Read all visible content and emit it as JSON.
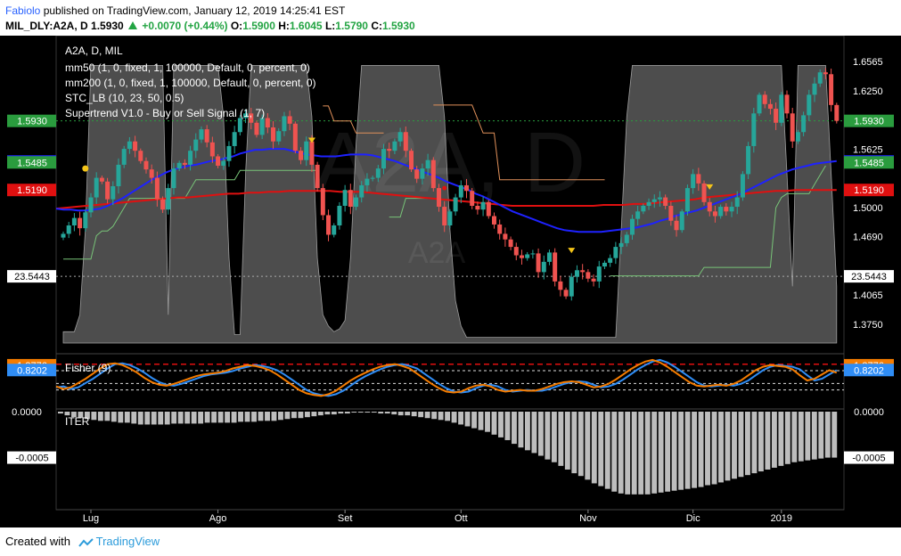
{
  "header": {
    "author": "Fabiolo",
    "published_text": "published on TradingView.com, January 12, 2019 14:25:41 EST",
    "symbol": "MIL_DLY:A2A, D",
    "price": "1.5930",
    "change": "+0.0070 (+0.44%)",
    "o_label": "O:",
    "o_value": "1.5900",
    "h_label": "H:",
    "h_value": "1.6045",
    "l_label": "L:",
    "l_value": "1.5790",
    "c_label": "C:",
    "c_value": "1.5930"
  },
  "footer": {
    "created_with": "Created with",
    "brand": "TradingView"
  },
  "colors": {
    "background": "#000000",
    "up_candle": "#26a69a",
    "down_candle": "#ef5350",
    "mm50": "#1e22ff",
    "mm200": "#e01010",
    "stc": "#8c8c8c",
    "supertrend_long": "#78c478",
    "supertrend_short": "#e0905a",
    "fisher": "#f57c00",
    "fisher_trigger": "#2f8df5",
    "iter_bars": "#bdbdbd",
    "last_price_label": "#2a9c3e"
  },
  "chart_data": {
    "type": "candlestick",
    "main_pane": {
      "symbol_title": "A2A, D, MIL",
      "watermark": "A2A, D",
      "watermark_sub": "A2A",
      "legend": [
        "mm50 (1, 0, fixed, 1, 100000, Default, 0, percent, 0)",
        "mm200 (1, 0, fixed, 1, 100000, Default, 0, percent, 0)",
        "STC_LB (10, 23, 50, 0.5)",
        "Supertrend V1.0 - Buy or Sell Signal (1, 7)"
      ],
      "ylim": [
        1.355,
        1.67
      ],
      "y_ticks": [
        "1.6565",
        "1.6250",
        "1.5625",
        "1.5000",
        "1.4690",
        "1.4065",
        "1.3750"
      ],
      "x_ticks": [
        {
          "label": "Lug",
          "bar": 5
        },
        {
          "label": "Ago",
          "bar": 28
        },
        {
          "label": "Set",
          "bar": 51
        },
        {
          "label": "Ott",
          "bar": 72
        },
        {
          "label": "Nov",
          "bar": 95
        },
        {
          "label": "Dic",
          "bar": 114
        },
        {
          "label": "2019",
          "bar": 130
        }
      ],
      "price_labels": [
        {
          "text": "1.5930",
          "value": 1.593,
          "color": "#2a9c3e"
        },
        {
          "text": "1.5495",
          "value": 1.5495,
          "color": "#1e22ff"
        },
        {
          "text": "1.5485",
          "value": 1.5485,
          "color": "#2a9c3e"
        },
        {
          "text": "1.5190",
          "value": 1.519,
          "color": "#e01010"
        }
      ],
      "stc_label": {
        "text": "23.5443",
        "value": 23.5443
      },
      "closes": [
        1.472,
        1.481,
        1.489,
        1.478,
        1.495,
        1.511,
        1.532,
        1.528,
        1.509,
        1.523,
        1.546,
        1.563,
        1.571,
        1.561,
        1.55,
        1.541,
        1.532,
        1.509,
        1.498,
        1.521,
        1.542,
        1.548,
        1.546,
        1.561,
        1.573,
        1.584,
        1.57,
        1.555,
        1.545,
        1.55,
        1.566,
        1.581,
        1.596,
        1.601,
        1.591,
        1.578,
        1.596,
        1.586,
        1.571,
        1.582,
        1.598,
        1.59,
        1.561,
        1.551,
        1.571,
        1.546,
        1.521,
        1.492,
        1.471,
        1.481,
        1.502,
        1.519,
        1.501,
        1.511,
        1.524,
        1.531,
        1.532,
        1.542,
        1.563,
        1.561,
        1.571,
        1.581,
        1.561,
        1.541,
        1.531,
        1.542,
        1.551,
        1.521,
        1.501,
        1.481,
        1.496,
        1.511,
        1.524,
        1.518,
        1.502,
        1.498,
        1.506,
        1.491,
        1.482,
        1.472,
        1.466,
        1.458,
        1.449,
        1.446,
        1.45,
        1.451,
        1.431,
        1.442,
        1.452,
        1.421,
        1.412,
        1.405,
        1.426,
        1.433,
        1.431,
        1.424,
        1.421,
        1.437,
        1.441,
        1.446,
        1.458,
        1.462,
        1.471,
        1.488,
        1.496,
        1.502,
        1.506,
        1.509,
        1.511,
        1.502,
        1.486,
        1.476,
        1.496,
        1.521,
        1.536,
        1.526,
        1.506,
        1.496,
        1.491,
        1.501,
        1.496,
        1.501,
        1.511,
        1.536,
        1.566,
        1.601,
        1.621,
        1.611,
        1.606,
        1.591,
        1.621,
        1.601,
        1.571,
        1.581,
        1.599,
        1.621,
        1.633,
        1.645,
        1.643,
        1.61,
        1.593
      ],
      "mm50": [
        1.499,
        1.498,
        1.498,
        1.497,
        1.497,
        1.498,
        1.499,
        1.502,
        1.506,
        1.51,
        1.515,
        1.52,
        1.525,
        1.53,
        1.534,
        1.538,
        1.541,
        1.543,
        1.545,
        1.546,
        1.548,
        1.55,
        1.551,
        1.553,
        1.555,
        1.558,
        1.56,
        1.562,
        1.562,
        1.563,
        1.563,
        1.563,
        1.561,
        1.559,
        1.557,
        1.556,
        1.555,
        1.555,
        1.555,
        1.556,
        1.557,
        1.557,
        1.557,
        1.556,
        1.554,
        1.552,
        1.55,
        1.547,
        1.544,
        1.541,
        1.538,
        1.535,
        1.532,
        1.528,
        1.525,
        1.522,
        1.519,
        1.515,
        1.512,
        1.508,
        1.504,
        1.5,
        1.496,
        1.493,
        1.49,
        1.487,
        1.484,
        1.481,
        1.478,
        1.476,
        1.475,
        1.474,
        1.474,
        1.474,
        1.474,
        1.475,
        1.476,
        1.477,
        1.478,
        1.479,
        1.481,
        1.483,
        1.486,
        1.488,
        1.491,
        1.493,
        1.495,
        1.497,
        1.5,
        1.503,
        1.506,
        1.509,
        1.512,
        1.515,
        1.519,
        1.523,
        1.527,
        1.531,
        1.535,
        1.538,
        1.541,
        1.543,
        1.545,
        1.547,
        1.548,
        1.549,
        1.55
      ],
      "mm200": [
        1.499,
        1.5,
        1.501,
        1.502,
        1.503,
        1.504,
        1.505,
        1.506,
        1.507,
        1.508,
        1.509,
        1.51,
        1.511,
        1.511,
        1.512,
        1.513,
        1.514,
        1.515,
        1.515,
        1.516,
        1.516,
        1.517,
        1.517,
        1.518,
        1.518,
        1.518,
        1.518,
        1.518,
        1.517,
        1.517,
        1.517,
        1.516,
        1.515,
        1.514,
        1.513,
        1.512,
        1.511,
        1.51,
        1.509,
        1.508,
        1.507,
        1.506,
        1.505,
        1.504,
        1.503,
        1.502,
        1.502,
        1.502,
        1.502,
        1.502,
        1.502,
        1.502,
        1.502,
        1.502,
        1.503,
        1.503,
        1.503,
        1.504,
        1.504,
        1.505,
        1.506,
        1.507,
        1.508,
        1.509,
        1.511,
        1.512,
        1.513,
        1.514,
        1.515,
        1.516,
        1.517,
        1.518,
        1.518,
        1.519,
        1.519,
        1.519,
        1.519,
        1.519
      ],
      "stc_percent": [
        4,
        4,
        4,
        10,
        40,
        98,
        98,
        98,
        98,
        98,
        98,
        98,
        98,
        98,
        98,
        98,
        98,
        98,
        98,
        10,
        98,
        98,
        98,
        98,
        98,
        98,
        98,
        98,
        98,
        80,
        30,
        3,
        3,
        60,
        98,
        98,
        98,
        98,
        98,
        98,
        98,
        98,
        98,
        98,
        98,
        80,
        30,
        10,
        6,
        4,
        5,
        8,
        30,
        70,
        98,
        98,
        98,
        98,
        98,
        98,
        98,
        98,
        98,
        98,
        98,
        98,
        98,
        98,
        98,
        80,
        40,
        15,
        6,
        2,
        2,
        2,
        2,
        2,
        2,
        2,
        2,
        2,
        2,
        2,
        2,
        2,
        2,
        2,
        2,
        2,
        2,
        2,
        2,
        2,
        2,
        2,
        2,
        2,
        2,
        2,
        2,
        40,
        80,
        98,
        98,
        98,
        98,
        98,
        98,
        98,
        98,
        98,
        98,
        98,
        98,
        98,
        98,
        98,
        98,
        98,
        98,
        98,
        98,
        98,
        98,
        98,
        98,
        98,
        98,
        98,
        98,
        60,
        20,
        98,
        98,
        98,
        98,
        98,
        98,
        60,
        20
      ],
      "supertrend_long": [
        1.445,
        1.445,
        1.445,
        1.445,
        1.445,
        1.445,
        1.47,
        1.475,
        1.475,
        1.48,
        1.49,
        1.5,
        1.51,
        1.51,
        1.51,
        1.51,
        1.51,
        1.51,
        1.51,
        1.51,
        1.51,
        1.51,
        1.51,
        1.52,
        1.53,
        1.53,
        1.53,
        1.53,
        1.53,
        1.53,
        1.53,
        1.53,
        1.54,
        1.54,
        1.54,
        1.54,
        1.54,
        1.54,
        1.54,
        1.54,
        1.54,
        1.54,
        1.54,
        1.54,
        1.54,
        1.54,
        1.54,
        null,
        null,
        null,
        null,
        null,
        null,
        null,
        null,
        null,
        null,
        null,
        null,
        1.49,
        1.49,
        1.49,
        1.51,
        1.51,
        1.51,
        1.51,
        1.51,
        null,
        null,
        null,
        null,
        null,
        null,
        null,
        null,
        null,
        null,
        null,
        null,
        null,
        null,
        null,
        null,
        null,
        null,
        null,
        null,
        null,
        null,
        null,
        null,
        null,
        null,
        null,
        null,
        null,
        null,
        null,
        null,
        1.427,
        1.427,
        1.427,
        1.427,
        1.427,
        1.427,
        1.427,
        1.427,
        1.427,
        1.427,
        1.427,
        1.427,
        1.427,
        1.427,
        1.427,
        1.427,
        1.427,
        1.436,
        1.436,
        1.436,
        1.436,
        1.436,
        1.436,
        1.436,
        1.436,
        1.436,
        1.436,
        1.436,
        1.436,
        1.436,
        1.5,
        1.511,
        1.515,
        1.515,
        1.515,
        1.515,
        1.515,
        1.525,
        1.535,
        1.545
      ],
      "supertrend_short": [
        null,
        null,
        null,
        null,
        null,
        null,
        null,
        null,
        null,
        null,
        null,
        null,
        null,
        null,
        null,
        null,
        null,
        null,
        null,
        null,
        null,
        null,
        null,
        null,
        null,
        null,
        null,
        null,
        null,
        null,
        null,
        null,
        null,
        null,
        null,
        null,
        null,
        null,
        null,
        null,
        null,
        null,
        null,
        null,
        null,
        null,
        null,
        1.609,
        1.609,
        1.593,
        1.593,
        1.593,
        1.593,
        1.58,
        1.58,
        1.58,
        1.58,
        1.58,
        1.58,
        null,
        null,
        null,
        null,
        null,
        null,
        null,
        null,
        1.61,
        1.61,
        1.61,
        1.61,
        1.61,
        1.61,
        1.61,
        1.61,
        1.595,
        1.58,
        1.58,
        1.58,
        1.53,
        1.53,
        1.53,
        1.53,
        1.53,
        1.53,
        1.53,
        1.53,
        1.53,
        1.53,
        1.53,
        1.53,
        1.53,
        1.53,
        1.53,
        1.53,
        1.53,
        1.53,
        1.53,
        1.53,
        null
      ]
    },
    "fisher_pane": {
      "title": "Fisher (9)",
      "ylim": [
        -3.0,
        2.2
      ],
      "labels": [
        {
          "text": "1.3776",
          "value": 1.3776,
          "color": "#f57c00"
        },
        {
          "text": "0.8202",
          "value": 0.8202,
          "color": "#2f8df5"
        }
      ],
      "levels": [
        1.5,
        0.75,
        -0.75,
        -1.5
      ],
      "fisher": [
        -1.1,
        -1.4,
        -1.2,
        -0.7,
        -0.2,
        0.4,
        1.0,
        1.5,
        1.6,
        1.4,
        1.0,
        0.5,
        -0.1,
        -0.6,
        -0.9,
        -1.0,
        -0.8,
        -0.5,
        -0.2,
        0.1,
        0.3,
        0.4,
        0.5,
        0.7,
        1.0,
        1.2,
        1.4,
        1.3,
        1.1,
        0.8,
        0.3,
        -0.3,
        -0.9,
        -1.5,
        -1.9,
        -2.1,
        -2.2,
        -2.0,
        -1.6,
        -1.0,
        -0.4,
        0.1,
        0.5,
        0.9,
        1.2,
        1.4,
        1.5,
        1.3,
        1.0,
        0.4,
        -0.2,
        -0.8,
        -1.3,
        -1.7,
        -1.8,
        -1.7,
        -1.3,
        -1.0,
        -0.9,
        -1.1,
        -1.5,
        -1.7,
        -1.6,
        -1.5,
        -1.6,
        -1.6,
        -1.4,
        -1.1,
        -0.8,
        -0.6,
        -0.5,
        -0.6,
        -0.9,
        -1.2,
        -1.1,
        -0.8,
        -0.3,
        0.3,
        0.9,
        1.4,
        1.8,
        2.0,
        1.7,
        1.2,
        0.6,
        0.0,
        -0.6,
        -1.0,
        -1.1,
        -1.0,
        -0.9,
        -1.0,
        -0.8,
        -0.4,
        0.2,
        0.8,
        1.2,
        1.4,
        1.3,
        1.2,
        0.9,
        0.2,
        -0.4,
        -0.2,
        0.3,
        0.8,
        0.5
      ],
      "trigger": [
        -1.2,
        -1.1,
        -1.4,
        -1.2,
        -0.7,
        -0.2,
        0.4,
        1.0,
        1.5,
        1.6,
        1.4,
        1.0,
        0.5,
        -0.1,
        -0.6,
        -0.9,
        -1.0,
        -0.8,
        -0.5,
        -0.2,
        0.1,
        0.3,
        0.4,
        0.5,
        0.7,
        1.0,
        1.2,
        1.4,
        1.3,
        1.1,
        0.8,
        0.3,
        -0.3,
        -0.9,
        -1.5,
        -1.9,
        -2.1,
        -2.2,
        -2.0,
        -1.6,
        -1.0,
        -0.4,
        0.1,
        0.5,
        0.9,
        1.2,
        1.4,
        1.5,
        1.3,
        1.0,
        0.4,
        -0.2,
        -0.8,
        -1.3,
        -1.7,
        -1.8,
        -1.7,
        -1.3,
        -1.0,
        -0.9,
        -1.1,
        -1.5,
        -1.7,
        -1.6,
        -1.5,
        -1.6,
        -1.6,
        -1.4,
        -1.1,
        -0.8,
        -0.6,
        -0.5,
        -0.6,
        -0.9,
        -1.2,
        -1.1,
        -0.8,
        -0.3,
        0.3,
        0.9,
        1.4,
        1.8,
        2.0,
        1.7,
        1.2,
        0.6,
        0.0,
        -0.6,
        -1.0,
        -1.1,
        -1.0,
        -0.9,
        -1.0,
        -0.8,
        -0.4,
        0.2,
        0.8,
        1.2,
        1.4,
        1.3,
        1.2,
        0.9,
        0.2,
        -0.4,
        -0.2,
        0.3,
        0.8
      ]
    },
    "iter_pane": {
      "title": "ITER",
      "ylim": [
        -0.00095,
        0.0
      ],
      "labels": [
        {
          "text": "0.0000",
          "value": 0.0
        },
        {
          "text": "-0.0005",
          "value": -0.0005
        }
      ],
      "values": [
        -2e-05,
        -4e-05,
        -6e-05,
        -7e-05,
        -8e-05,
        -9e-05,
        -0.0001,
        -0.0001,
        -0.00011,
        -0.00012,
        -0.00012,
        -0.00013,
        -0.00014,
        -0.00014,
        -0.00014,
        -0.00014,
        -0.00014,
        -0.00013,
        -0.00013,
        -0.00013,
        -0.00013,
        -0.00013,
        -0.00012,
        -0.00012,
        -0.00012,
        -0.00012,
        -0.00012,
        -0.00011,
        -0.00011,
        -0.00011,
        -0.0001,
        -0.0001,
        -0.0001,
        -9e-05,
        -8e-05,
        -7e-05,
        -7e-05,
        -6e-05,
        -5e-05,
        -4e-05,
        -3e-05,
        -3e-05,
        -2e-05,
        -2e-05,
        -1e-05,
        -1e-05,
        -1e-05,
        -1e-05,
        -2e-05,
        -2e-05,
        -3e-05,
        -4e-05,
        -4e-05,
        -5e-05,
        -6e-05,
        -7e-05,
        -8e-05,
        -9e-05,
        -0.0001,
        -0.00012,
        -0.00014,
        -0.00016,
        -0.00018,
        -0.0002,
        -0.00022,
        -0.00025,
        -0.00028,
        -0.00031,
        -0.00035,
        -0.00039,
        -0.00042,
        -0.00045,
        -0.00048,
        -0.00052,
        -0.00055,
        -0.00059,
        -0.00063,
        -0.00067,
        -0.0007,
        -0.00074,
        -0.00078,
        -0.00081,
        -0.00084,
        -0.00087,
        -0.00089,
        -0.0009,
        -0.0009,
        -0.0009,
        -0.0009,
        -0.00089,
        -0.00088,
        -0.00087,
        -0.00086,
        -0.00085,
        -0.00084,
        -0.00083,
        -0.00082,
        -0.0008,
        -0.00079,
        -0.00077,
        -0.00075,
        -0.00073,
        -0.00071,
        -0.00069,
        -0.00067,
        -0.00065,
        -0.00063,
        -0.00061,
        -0.00059,
        -0.00057,
        -0.00055,
        -0.00054,
        -0.00053,
        -0.00052,
        -0.00051,
        -0.0005,
        -0.0005
      ]
    }
  }
}
